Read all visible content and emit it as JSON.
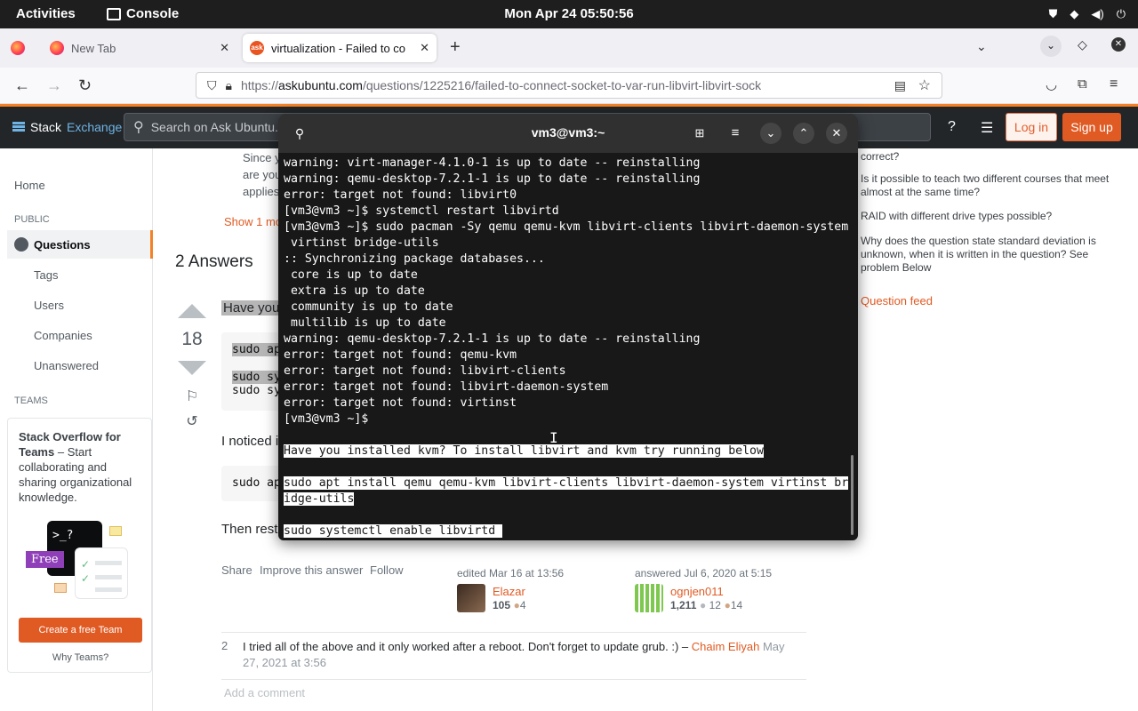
{
  "system": {
    "activities": "Activities",
    "app_name": "Console",
    "clock": "Mon Apr 24  05:50:56"
  },
  "browser": {
    "tabs": [
      {
        "label": "New Tab"
      },
      {
        "label": "virtualization - Failed to co"
      }
    ],
    "url_prefix": "https://",
    "url_host": "askubuntu.com",
    "url_path": "/questions/1225216/failed-to-connect-socket-to-var-run-libvirt-libvirt-sock"
  },
  "se_header": {
    "logo_a": "Stack",
    "logo_b": "Exchange",
    "search_placeholder": "Search on Ask Ubuntu...",
    "login": "Log in",
    "signup": "Sign up"
  },
  "left_nav": {
    "home": "Home",
    "public": "PUBLIC",
    "questions": "Questions",
    "tags": "Tags",
    "users": "Users",
    "companies": "Companies",
    "unanswered": "Unanswered",
    "teams_heading": "TEAMS",
    "teams_title": "Stack Overflow for Teams",
    "teams_text": " – Start collaborating and sharing organizational knowledge.",
    "teams_prompt": ">_?",
    "teams_free": "Free",
    "teams_cta": "Create a free Team",
    "teams_why": "Why Teams?"
  },
  "main": {
    "frag_since": "Since y",
    "frag_are": "are you",
    "frag_applies": "applies",
    "show_more": "Show 1 mo",
    "answers_heading": "2 Answers",
    "answer_first": "Have you",
    "vote_count": "18",
    "code1_line1": "sudo ap",
    "code1_line2": "sudo sy",
    "code1_line3": "sudo sy",
    "noticed": "I noticed i",
    "code2": "sudo ap",
    "then_rest": "Then rest",
    "share": "Share",
    "improve": "Improve this answer",
    "follow": "Follow",
    "edited": "edited Mar 16 at 13:56",
    "editor_name": "Elazar",
    "editor_rep": "105",
    "editor_bronze": "4",
    "answered": "answered Jul 6, 2020 at 5:15",
    "answerer_name": "ognjen011",
    "answerer_rep": "1,211",
    "answerer_silver": "12",
    "answerer_bronze": "14",
    "comment_score": "2",
    "comment_text": "I tried all of the above and it only worked after a reboot. Don't forget to update grub. :) –",
    "comment_author": "Chaim Eliyah",
    "comment_date_a": "May",
    "comment_date_b": "27, 2021 at 3:56",
    "add_comment": "Add a comment"
  },
  "right_col": {
    "items": [
      "correct?",
      "Is it possible to teach two different courses that meet almost at the same time?",
      "RAID with different drive types possible?",
      "Why does the question state standard deviation is unknown, when it is written in the question? See problem Below"
    ],
    "feed": "Question feed"
  },
  "terminal": {
    "title": "vm3@vm3:~",
    "lines": [
      "warning: virt-manager-4.1.0-1 is up to date -- reinstalling",
      "warning: qemu-desktop-7.2.1-1 is up to date -- reinstalling",
      "error: target not found: libvirt0",
      "[vm3@vm3 ~]$ systemctl restart libvirtd",
      "[vm3@vm3 ~]$ sudo pacman -Sy qemu qemu-kvm libvirt-clients libvirt-daemon-system",
      " virtinst bridge-utils",
      ":: Synchronizing package databases...",
      " core is up to date",
      " extra is up to date",
      " community is up to date",
      " multilib is up to date",
      "warning: qemu-desktop-7.2.1-1 is up to date -- reinstalling",
      "error: target not found: qemu-kvm",
      "error: target not found: libvirt-clients",
      "error: target not found: libvirt-daemon-system",
      "error: target not found: virtinst",
      "[vm3@vm3 ~]$ ",
      ""
    ],
    "pasted": [
      "Have you installed kvm? To install libvirt and kvm try running below",
      "",
      "sudo apt install qemu qemu-kvm libvirt-clients libvirt-daemon-system virtinst br",
      "idge-utils",
      "",
      "sudo systemctl enable libvirtd "
    ]
  }
}
